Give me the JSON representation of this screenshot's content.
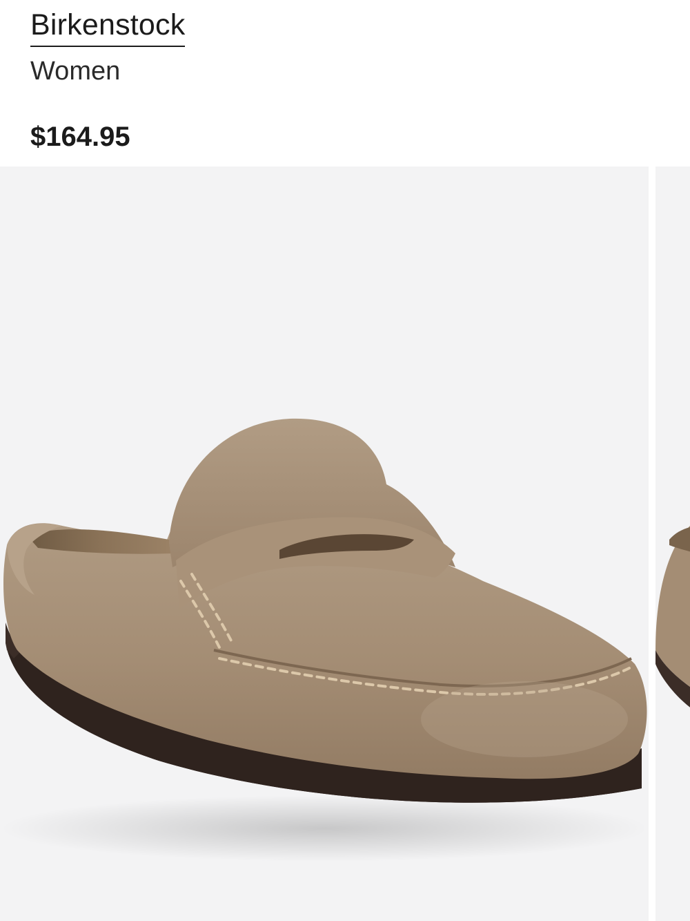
{
  "product": {
    "brand": "Birkenstock",
    "category": "Women",
    "price": "$164.95"
  },
  "gallery": {
    "images": [
      {
        "subject": "taupe suede penny loafer mule with dark rubber sole"
      },
      {
        "subject": "taupe suede penny loafer mule (partial, next image)"
      }
    ]
  },
  "colors": {
    "text": "#1b1b1b",
    "image_bg": "#f3f3f4",
    "suede": "#a8927a",
    "sole": "#3a2c27",
    "stitching": "#dcc8aa"
  }
}
